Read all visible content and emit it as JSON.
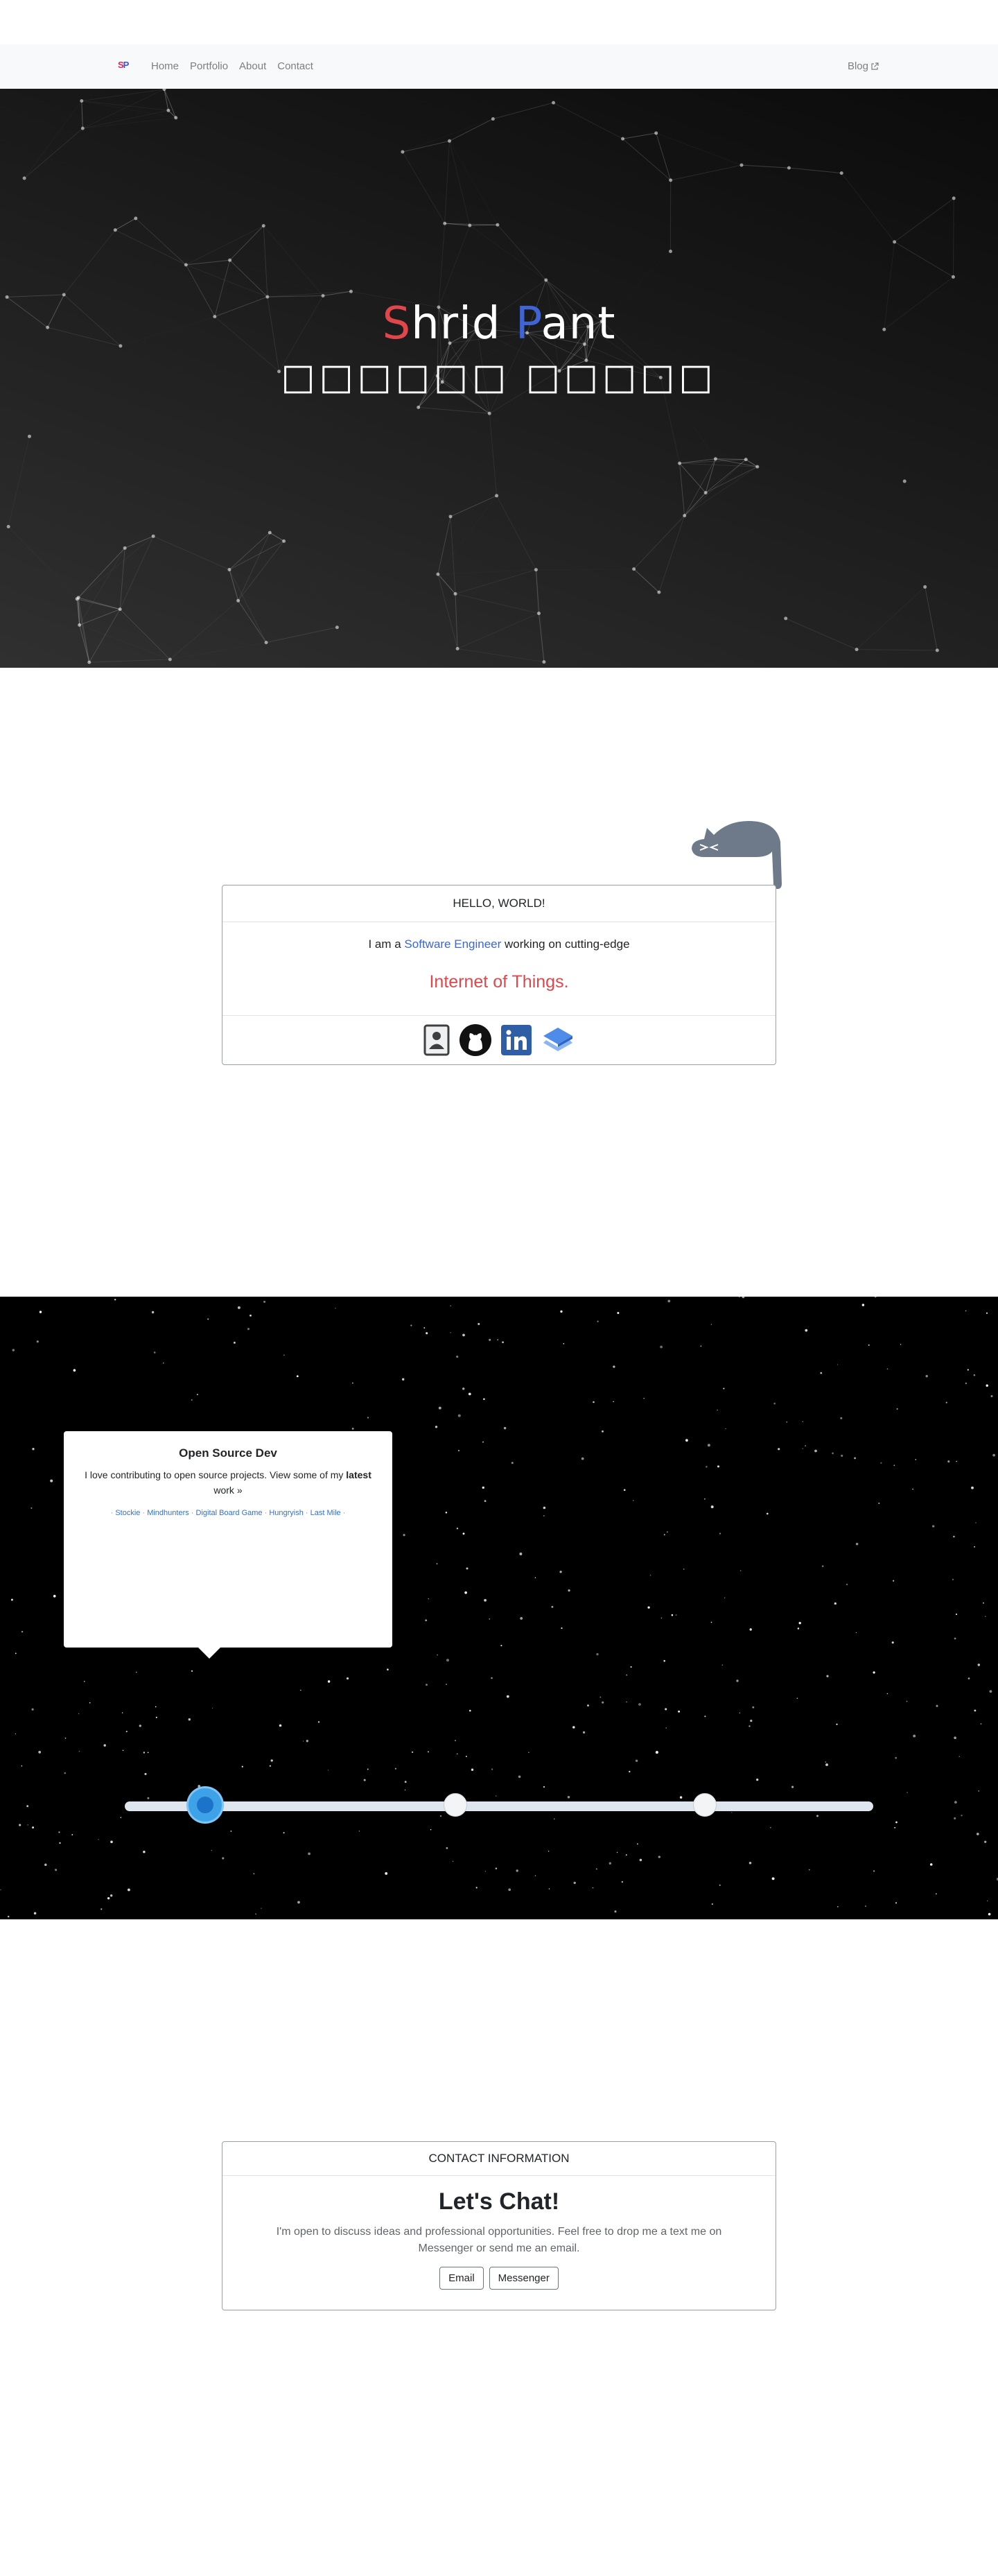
{
  "nav": {
    "brand_s": "S",
    "brand_p": "P",
    "links": [
      "Home",
      "Portfolio",
      "About",
      "Contact"
    ],
    "blog": "Blog"
  },
  "hero": {
    "title_first_letter": "S",
    "title_first_rest": "hrid",
    "title_last_letter": "P",
    "title_last_rest": "ant",
    "subtitle": "□□□□□□ □□□□□"
  },
  "about": {
    "header": "HELLO, WORLD!",
    "line_prefix": "I am a",
    "line_highlight": "Software Engineer",
    "line_suffix": "working on cutting-edge",
    "iot": "Internet of Things.",
    "icons": [
      "resume-icon",
      "github-icon",
      "linkedin-icon",
      "stack-icon"
    ]
  },
  "opensource": {
    "title": "Open Source Dev",
    "text_prefix": "I love contributing to open source projects. View some of my",
    "text_bold": "latest",
    "text_suffix": "work »",
    "projects": [
      "Stockie",
      "Mindhunters",
      "Digital Board Game",
      "Hungryish",
      "Last Mile"
    ],
    "timeline_active_index": 0
  },
  "contact": {
    "header": "CONTACT INFORMATION",
    "title": "Let's Chat!",
    "text": "I'm open to discuss ideas and professional opportunities. Feel free to drop me a text me on Messenger or send me an email.",
    "buttons": [
      "Email",
      "Messenger"
    ]
  },
  "colors": {
    "red": "#e0474c",
    "blue": "#3e64d6",
    "timeline_active": "#3ea2e8"
  }
}
